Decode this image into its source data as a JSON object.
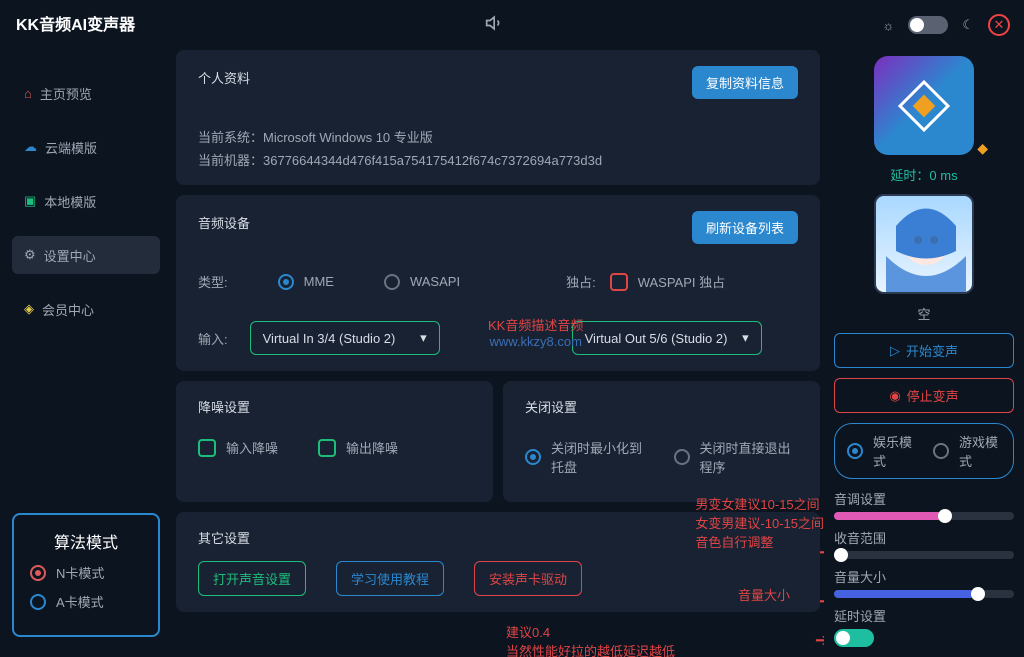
{
  "brand": "KK音频AI变声器",
  "latency_label": "延时：0 ms",
  "sidebar": {
    "items": [
      {
        "label": "主页预览",
        "color": "#e05a5a",
        "icon": "home"
      },
      {
        "label": "云端模版",
        "color": "#2b88cf",
        "icon": "cloud"
      },
      {
        "label": "本地模版",
        "color": "#1dbd7c",
        "icon": "folder"
      },
      {
        "label": "设置中心",
        "color": "#a0a8b5",
        "icon": "gear",
        "active": true
      },
      {
        "label": "会员中心",
        "color": "#e0c94a",
        "icon": "diamond"
      }
    ]
  },
  "algo": {
    "title": "算法模式",
    "n": "N卡模式",
    "a": "A卡模式"
  },
  "profile": {
    "title": "个人资料",
    "copy_btn": "复制资料信息",
    "os_label": "当前系统：Microsoft Windows 10 专业版",
    "machine_label": "当前机器：36776644344d476f415a754175412f674c7372694a773d3d"
  },
  "audio": {
    "title": "音频设备",
    "refresh_btn": "刷新设备列表",
    "type_label": "类型:",
    "mme": "MME",
    "wasapi": "WASAPI",
    "excl_label": "独占:",
    "excl_opt": "WASPAPI 独占",
    "input_label": "输入:",
    "in_sel": "Virtual In 3/4 (Studio 2)",
    "out_sel": "Virtual Out 5/6 (Studio 2)",
    "watermark1": "KK音频描述音频",
    "watermark2": "www.kkzy8.com"
  },
  "noise": {
    "title": "降噪设置",
    "in": "输入降噪",
    "out": "输出降噪"
  },
  "close": {
    "title": "关闭设置",
    "a": "关闭时最小化到托盘",
    "b": "关闭时直接退出程序"
  },
  "other": {
    "title": "其它设置",
    "b1": "打开声音设置",
    "b2": "学习使用教程",
    "b3": "安装声卡驱动",
    "tip1a": "男变女建议10-15之间",
    "tip1b": "女变男建议-10-15之间",
    "tip1c": "音色自行调整",
    "tip2": "音量大小",
    "tip3a": "建议0.4",
    "tip3b": "当然性能好拉的越低延迟越低"
  },
  "right": {
    "voice_name": "空",
    "start": "开始变声",
    "stop": "停止变声",
    "mode_a": "娱乐模式",
    "mode_b": "游戏模式",
    "sliders": {
      "pitch": "音调设置",
      "range": "收音范围",
      "vol": "音量大小",
      "delay": "延时设置"
    }
  }
}
